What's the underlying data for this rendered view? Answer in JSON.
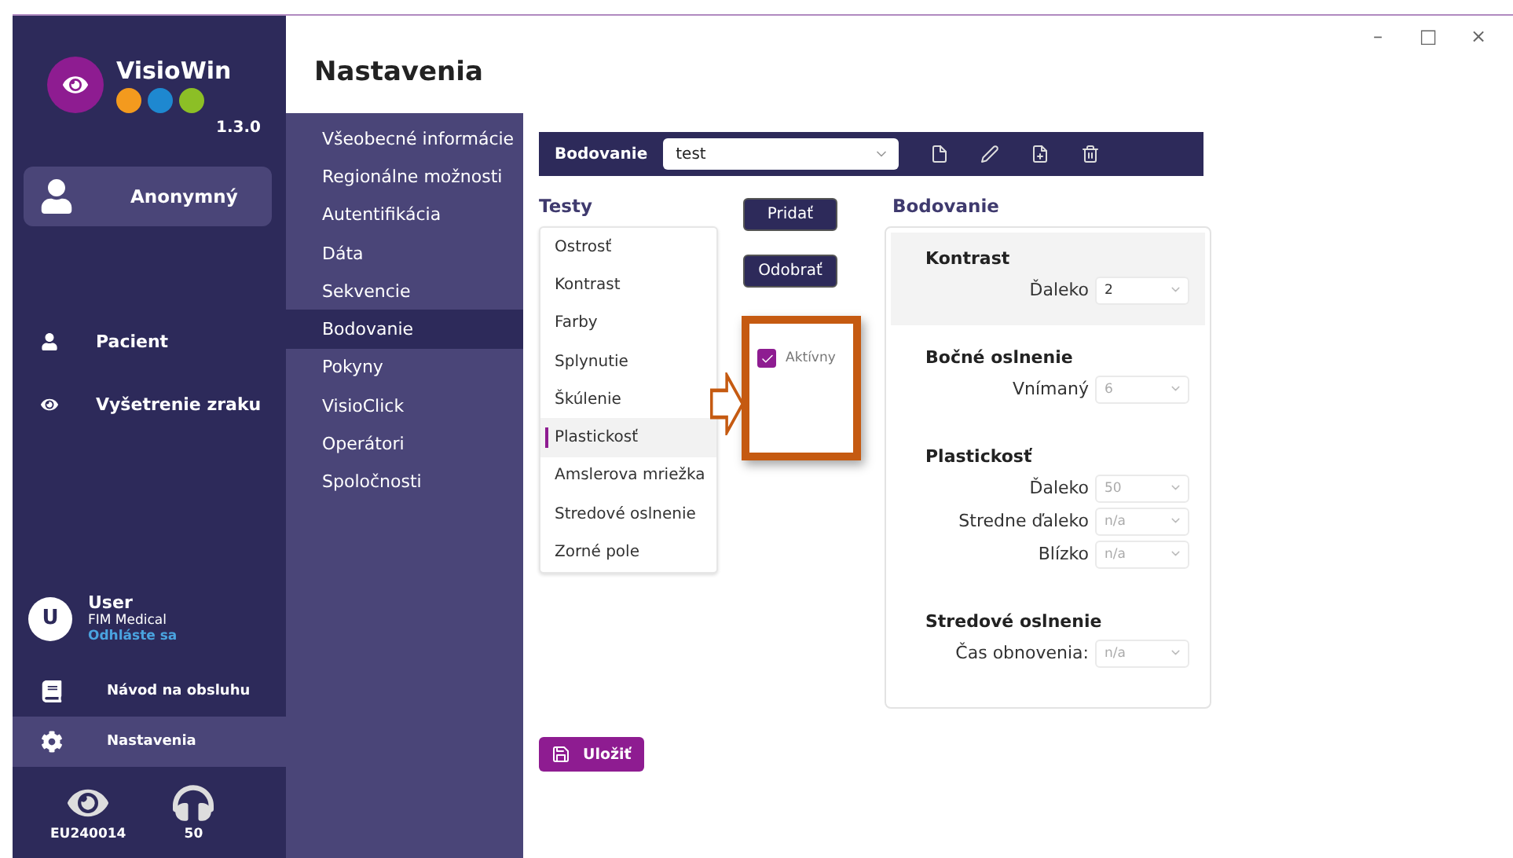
{
  "window": {
    "controls": [
      "–",
      "□",
      "×"
    ]
  },
  "app": {
    "name": "VisioWin",
    "version": "1.3.0",
    "user_mode": "Anonymný"
  },
  "nav": [
    {
      "label": "Pacient"
    },
    {
      "label": "Vyšetrenie zraku"
    }
  ],
  "user": {
    "initial": "U",
    "name": "User",
    "company": "FIM Medical",
    "logout": "Odhláste sa"
  },
  "bottom_nav": [
    {
      "label": "Návod na obsluhu",
      "selected": false
    },
    {
      "label": "Nastavenia",
      "selected": true
    }
  ],
  "devices": [
    {
      "label": "EU240014",
      "kind": "vision"
    },
    {
      "label": "50",
      "kind": "headset"
    }
  ],
  "page_title": "Nastavenia",
  "submenu": [
    {
      "label": "Všeobecné informácie",
      "selected": false
    },
    {
      "label": "Regionálne možnosti",
      "selected": false
    },
    {
      "label": "Autentifikácia",
      "selected": false
    },
    {
      "label": "Dáta",
      "selected": false
    },
    {
      "label": "Sekvencie",
      "selected": false
    },
    {
      "label": "Bodovanie",
      "selected": true
    },
    {
      "label": "Pokyny",
      "selected": false
    },
    {
      "label": "VisioClick",
      "selected": false
    },
    {
      "label": "Operátori",
      "selected": false
    },
    {
      "label": "Spoločnosti",
      "selected": false
    }
  ],
  "toolbar": {
    "label": "Bodovanie",
    "value": "test"
  },
  "tests": {
    "title": "Testy",
    "items": [
      {
        "label": "Ostrosť",
        "selected": false
      },
      {
        "label": "Kontrast",
        "selected": false
      },
      {
        "label": "Farby",
        "selected": false
      },
      {
        "label": "Splynutie",
        "selected": false
      },
      {
        "label": "Škúlenie",
        "selected": false
      },
      {
        "label": "Plastickosť",
        "selected": true
      },
      {
        "label": "Amslerova mriežka",
        "selected": false
      },
      {
        "label": "Stredové oslnenie",
        "selected": false
      },
      {
        "label": "Zorné pole",
        "selected": false
      }
    ]
  },
  "buttons": [
    "Pridať",
    "Odobrať"
  ],
  "active": {
    "label": "Aktívny",
    "checked": true
  },
  "scoring": {
    "title": "Bodovanie",
    "sections": [
      {
        "title": "Kontrast",
        "highlighted": true,
        "fields": [
          {
            "label": "Ďaleko",
            "value": "2",
            "disabled": false
          }
        ]
      },
      {
        "title": "Bočné oslnenie",
        "highlighted": false,
        "fields": [
          {
            "label": "Vnímaný",
            "value": "6",
            "disabled": true
          }
        ]
      },
      {
        "title": "Plastickosť",
        "highlighted": false,
        "fields": [
          {
            "label": "Ďaleko",
            "value": "50",
            "disabled": true
          },
          {
            "label": "Stredne ďaleko",
            "value": "n/a",
            "disabled": true
          },
          {
            "label": "Blízko",
            "value": "n/a",
            "disabled": true
          }
        ]
      },
      {
        "title": "Stredové oslnenie",
        "highlighted": false,
        "fields": [
          {
            "label": "Čas obnovenia:",
            "value": "n/a",
            "disabled": true
          }
        ]
      }
    ]
  },
  "save": "Uložiť"
}
